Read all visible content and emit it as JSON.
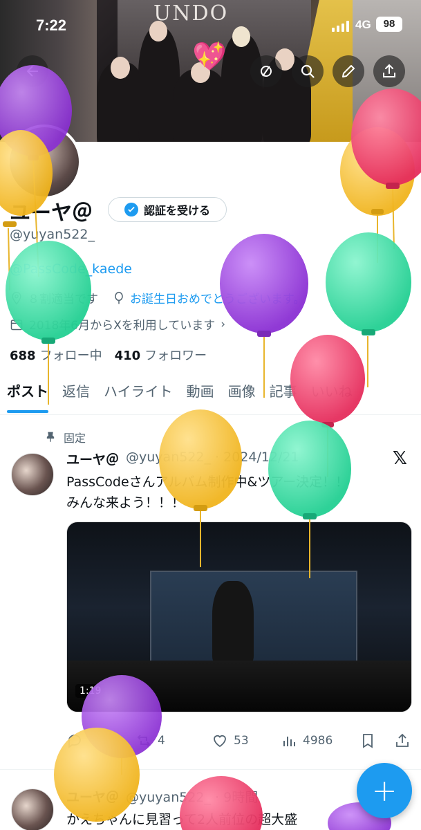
{
  "status_bar": {
    "time": "7:22",
    "network": "4G",
    "battery": "98"
  },
  "banner": {
    "sign_text": "UNDO"
  },
  "header": {
    "back_icon": "arrow-left-icon",
    "circle_icon": "circle-slash-icon",
    "search_icon": "search-icon",
    "edit_icon": "pencil-icon",
    "share_icon": "share-icon"
  },
  "profile": {
    "display_name": "ユーヤ＠",
    "verify_button": "認証を受ける",
    "handle": "@yuyan522_",
    "bio_link": "@PassCode_kaede",
    "location": "８割適当です",
    "birthday_text": "お誕生日おめでとうございます。",
    "joined": "2018年6月からXを利用しています",
    "following_count": "688",
    "following_label": "フォロー中",
    "followers_count": "410",
    "followers_label": "フォロワー"
  },
  "tabs": [
    "ポスト",
    "返信",
    "ハイライト",
    "動画",
    "画像",
    "記事",
    "いいね"
  ],
  "pinned_post": {
    "pinned_label": "固定",
    "author": "ユーヤ＠",
    "handle_date": "@yuyan522_ · 2024/12/21",
    "text_line1": "PassCodeさんアルバム制作中&ツアー決定！！",
    "text_line2": "みんな来よう！！！",
    "media_duration": "1:19",
    "replies": "",
    "reposts": "4",
    "likes": "53",
    "views": "4986"
  },
  "second_post": {
    "author": "ユーヤ＠",
    "handle_time": "@yuyan522_ · 9時間",
    "text": "かえちゃんに見習って2人前位の超大盛"
  },
  "fab": {
    "label": "+"
  },
  "colors": {
    "accent": "#1d9bf0",
    "text_primary": "#0f1419",
    "text_secondary": "#536471",
    "balloon_purple": "#a24fe0",
    "balloon_yellow": "#f6c33a",
    "balloon_green": "#3fe0a6",
    "balloon_pink": "#f0466e"
  }
}
